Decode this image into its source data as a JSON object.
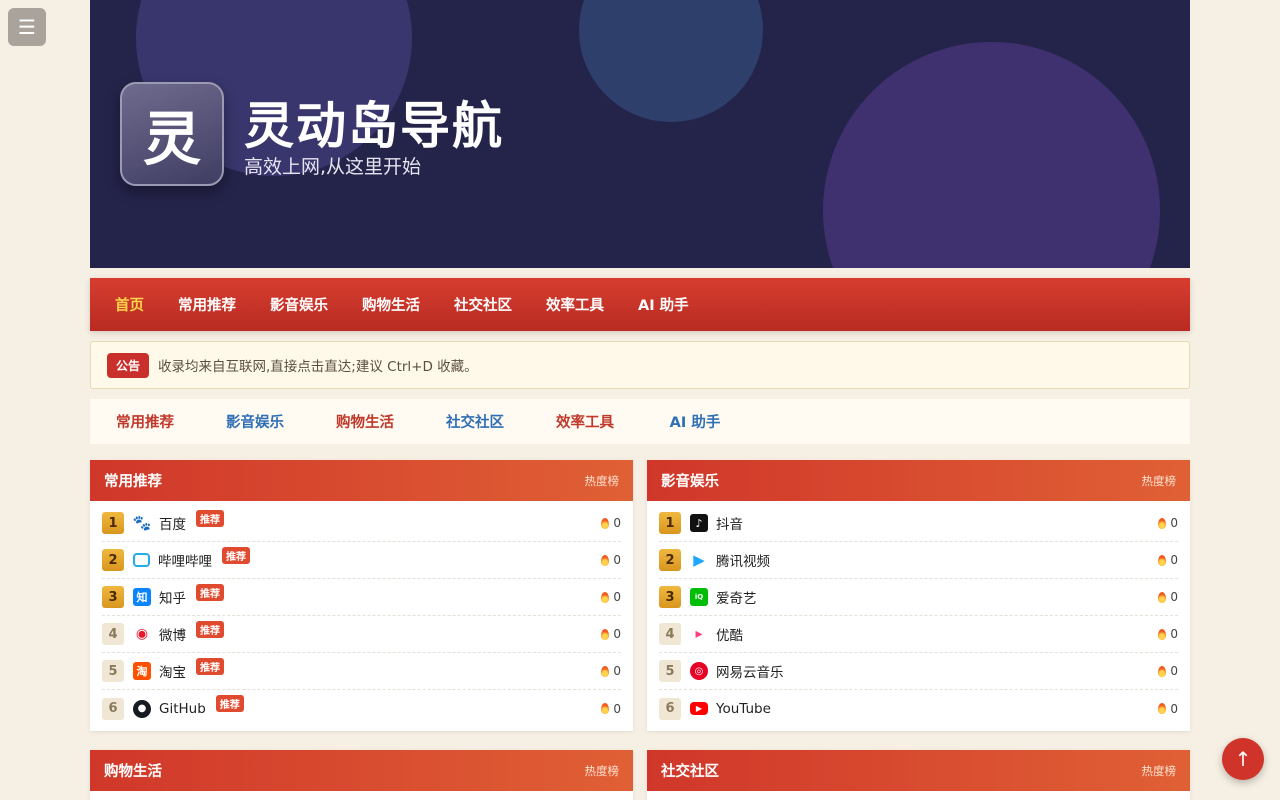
{
  "menu_toggle_icon": "☰",
  "hero": {
    "logo_char": "灵",
    "title": "灵动岛导航",
    "subtitle": "高效上网,从这里开始"
  },
  "nav": {
    "items": [
      "首页",
      "常用推荐",
      "影音娱乐",
      "购物生活",
      "社交社区",
      "效率工具",
      "AI 助手"
    ]
  },
  "notice": {
    "badge": "公告",
    "text": "收录均来自互联网,直接点击直达;建议 Ctrl+D 收藏。"
  },
  "quicknav": {
    "items": [
      "常用推荐",
      "影音娱乐",
      "购物生活",
      "社交社区",
      "效率工具",
      "AI 助手"
    ]
  },
  "cards": [
    {
      "title": "常用推荐",
      "hot_label": "热度榜",
      "items": [
        {
          "rank": "1",
          "name": "百度",
          "tag": "推荐",
          "heat": "0",
          "icon": "baidu-icon"
        },
        {
          "rank": "2",
          "name": "哔哩哔哩",
          "tag": "推荐",
          "heat": "0",
          "icon": "bilibili-icon"
        },
        {
          "rank": "3",
          "name": "知乎",
          "tag": "推荐",
          "heat": "0",
          "icon": "zhihu-icon"
        },
        {
          "rank": "4",
          "name": "微博",
          "tag": "推荐",
          "heat": "0",
          "icon": "weibo-icon"
        },
        {
          "rank": "5",
          "name": "淘宝",
          "tag": "推荐",
          "heat": "0",
          "icon": "taobao-icon"
        },
        {
          "rank": "6",
          "name": "GitHub",
          "tag": "推荐",
          "heat": "0",
          "icon": "github-icon"
        }
      ]
    },
    {
      "title": "影音娱乐",
      "hot_label": "热度榜",
      "items": [
        {
          "rank": "1",
          "name": "抖音",
          "heat": "0",
          "icon": "douyin-icon"
        },
        {
          "rank": "2",
          "name": "腾讯视频",
          "heat": "0",
          "icon": "tencent-video-icon"
        },
        {
          "rank": "3",
          "name": "爱奇艺",
          "heat": "0",
          "icon": "iqiyi-icon"
        },
        {
          "rank": "4",
          "name": "优酷",
          "heat": "0",
          "icon": "youku-icon"
        },
        {
          "rank": "5",
          "name": "网易云音乐",
          "heat": "0",
          "icon": "netease-music-icon"
        },
        {
          "rank": "6",
          "name": "YouTube",
          "heat": "0",
          "icon": "youtube-icon"
        }
      ]
    },
    {
      "title": "购物生活",
      "hot_label": "热度榜"
    },
    {
      "title": "社交社区",
      "hot_label": "热度榜"
    }
  ],
  "back_top_icon": "↑"
}
